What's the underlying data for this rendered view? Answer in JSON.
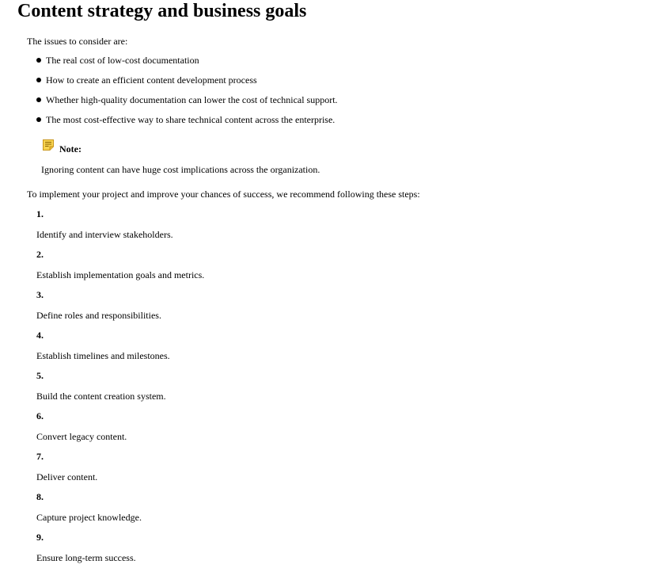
{
  "title": "Content strategy and business goals",
  "intro": "The issues to consider are:",
  "issues": [
    "The real cost of low-cost documentation",
    "How to create an efficient content development process",
    "Whether high-quality documentation can lower the cost of technical support.",
    "The most cost-effective way to share technical content across the enterprise."
  ],
  "note": {
    "icon": "note-icon",
    "label": "Note:",
    "text": "Ignoring content can have huge cost implications across the organization."
  },
  "steps_intro": "To implement your project and improve your chances of success, we recommend following these steps:",
  "steps": [
    {
      "number": "1.",
      "text": "Identify and interview stakeholders."
    },
    {
      "number": "2.",
      "text": "Establish implementation goals and metrics."
    },
    {
      "number": "3.",
      "text": "Define roles and responsibilities."
    },
    {
      "number": "4.",
      "text": "Establish timelines and milestones."
    },
    {
      "number": "5.",
      "text": "Build the content creation system."
    },
    {
      "number": "6.",
      "text": "Convert legacy content."
    },
    {
      "number": "7.",
      "text": "Deliver content."
    },
    {
      "number": "8.",
      "text": "Capture project knowledge."
    },
    {
      "number": "9.",
      "text": "Ensure long-term success."
    }
  ],
  "colors": {
    "note_icon_fill": "#f7d34f",
    "note_icon_border": "#c9961a"
  }
}
